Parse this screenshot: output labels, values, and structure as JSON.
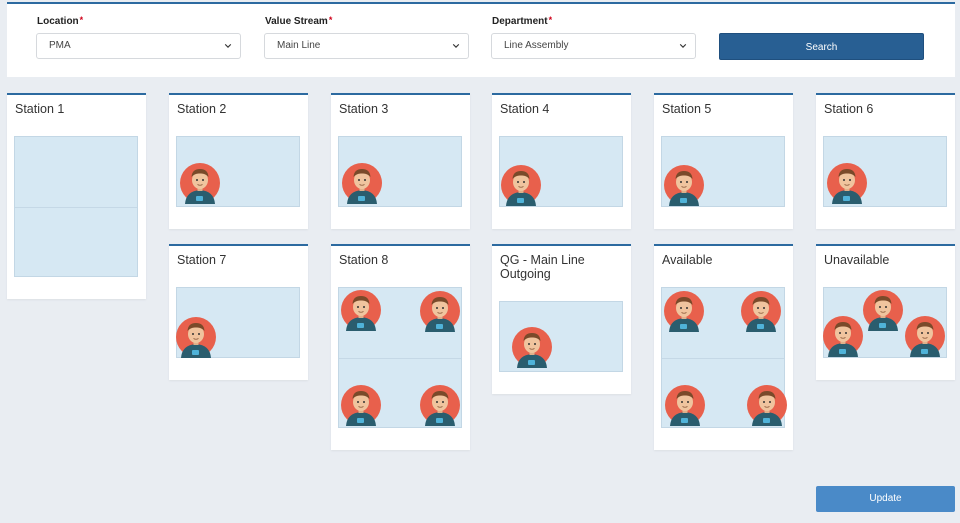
{
  "filters": {
    "location": {
      "label": "Location",
      "value": "PMA",
      "required_mark": "*"
    },
    "value_stream": {
      "label": "Value Stream",
      "value": "Main Line",
      "required_mark": "*"
    },
    "department": {
      "label": "Department",
      "value": "Line Assembly",
      "required_mark": "*"
    },
    "search_label": "Search"
  },
  "stations": [
    {
      "title": "Station 1"
    },
    {
      "title": "Station 2"
    },
    {
      "title": "Station 3"
    },
    {
      "title": "Station 4"
    },
    {
      "title": "Station 5"
    },
    {
      "title": "Station 6"
    },
    {
      "title": "Station 7"
    },
    {
      "title": "Station 8"
    },
    {
      "title": "QG - Main Line Outgoing"
    },
    {
      "title": "Available"
    },
    {
      "title": "Unavailable"
    }
  ],
  "update_label": "Update",
  "colors": {
    "accent": "#285f93",
    "slot": "#d6e8f3",
    "avatar_bg": "#e8604c",
    "shirt": "#2a5d6e"
  },
  "icons": {
    "dropdown": "chevron-down-icon",
    "worker": "worker-avatar-icon"
  }
}
